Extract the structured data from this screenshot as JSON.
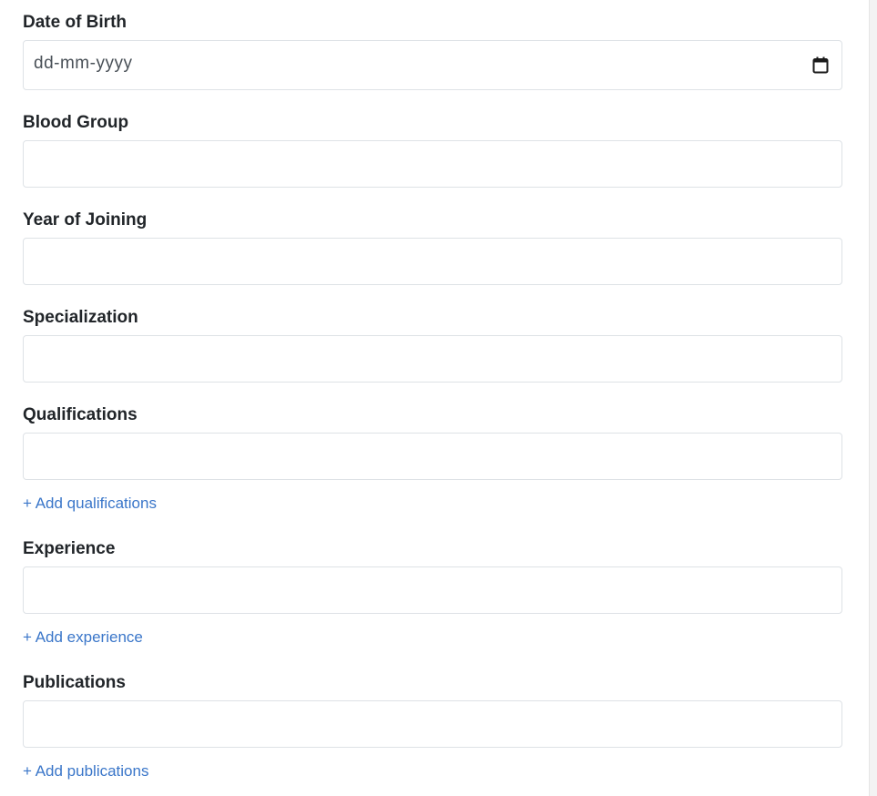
{
  "form": {
    "date_of_birth": {
      "label": "Date of Birth",
      "placeholder": "dd-mm-yyyy",
      "value": ""
    },
    "blood_group": {
      "label": "Blood Group",
      "value": ""
    },
    "year_of_joining": {
      "label": "Year of Joining",
      "value": ""
    },
    "specialization": {
      "label": "Specialization",
      "value": ""
    },
    "qualifications": {
      "label": "Qualifications",
      "value": "",
      "add_link": "+ Add qualifications"
    },
    "experience": {
      "label": "Experience",
      "value": "",
      "add_link": "+ Add experience"
    },
    "publications": {
      "label": "Publications",
      "value": "",
      "add_link": "+ Add publications"
    }
  },
  "icons": {
    "date_picker": "calendar-icon"
  },
  "colors": {
    "link": "#3a76c9",
    "input_border": "#dee2e6",
    "label_text": "#212529"
  }
}
